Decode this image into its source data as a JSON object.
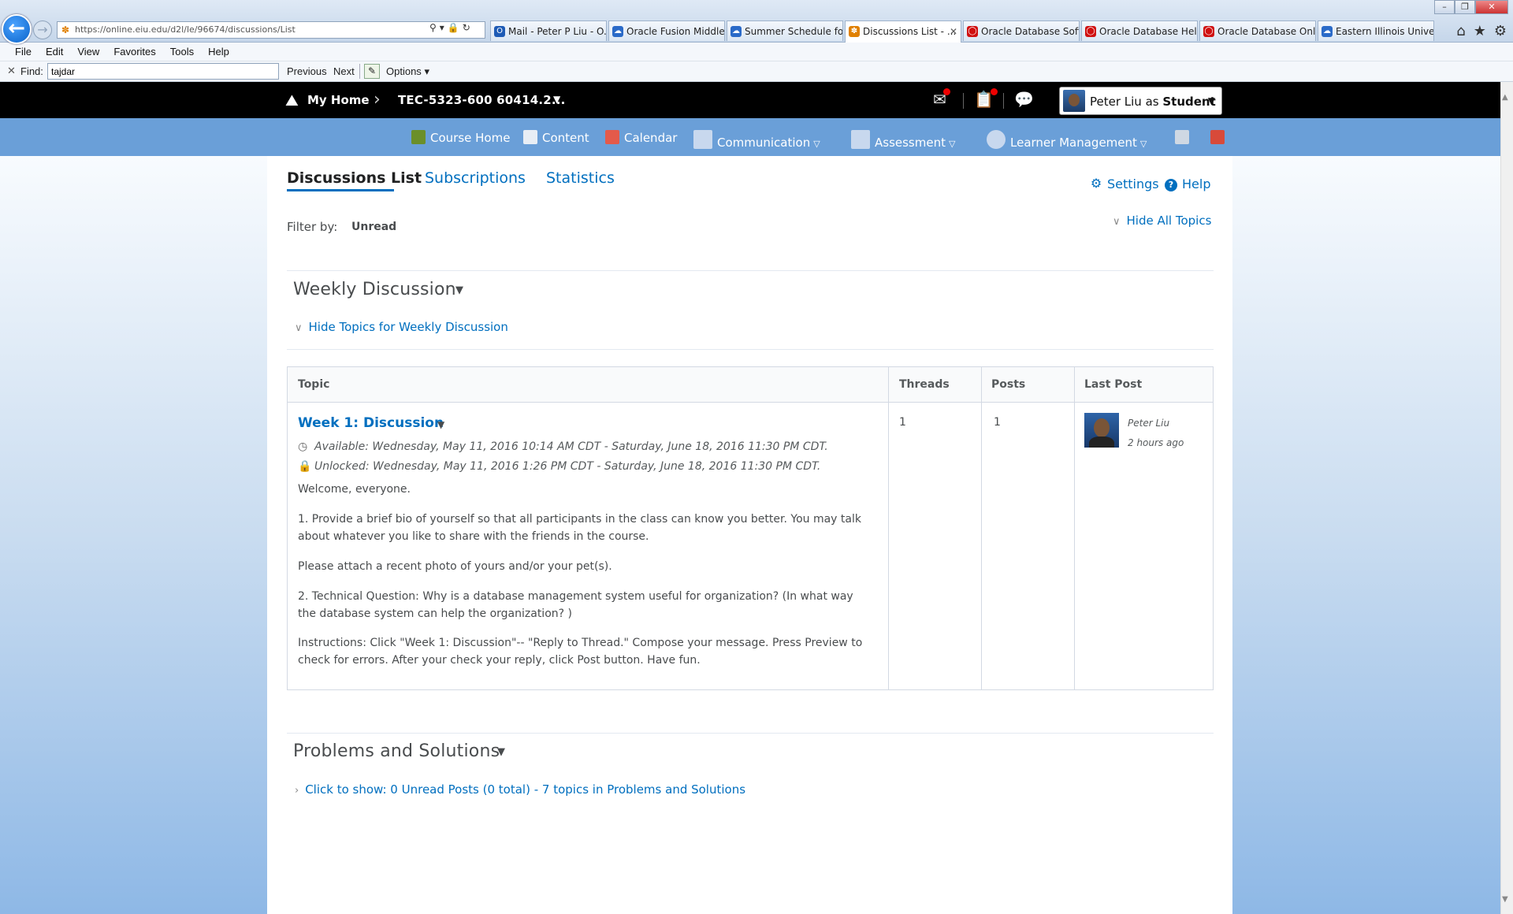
{
  "browser": {
    "address": "https://online.eiu.edu/d2l/le/96674/discussions/List",
    "tabs": [
      {
        "label": "Mail - Peter P Liu - O...",
        "icon": "outlook-icon",
        "color": "#1e5bb5"
      },
      {
        "label": "Oracle Fusion Middle...",
        "icon": "page-icon",
        "color": "#2a6ac8"
      },
      {
        "label": "Summer Schedule fo...",
        "icon": "page-icon",
        "color": "#2a6ac8"
      },
      {
        "label": "Discussions List - ...",
        "icon": "d2l-icon",
        "color": "#e08000",
        "active": true
      },
      {
        "label": "Oracle Database Soft...",
        "icon": "oracle-icon",
        "color": "#d01010"
      },
      {
        "label": "Oracle Database Hel...",
        "icon": "oracle-icon",
        "color": "#d01010"
      },
      {
        "label": "Oracle Database Onli...",
        "icon": "oracle-icon",
        "color": "#d01010"
      },
      {
        "label": "Eastern Illinois Unive...",
        "icon": "page-icon",
        "color": "#2a6ac8"
      }
    ],
    "menu": [
      "File",
      "Edit",
      "View",
      "Favorites",
      "Tools",
      "Help"
    ],
    "find": {
      "label": "Find:",
      "value": "tajdar",
      "previous": "Previous",
      "next": "Next",
      "options": "Options"
    }
  },
  "topnav": {
    "home": "My Home",
    "course": "TEC-5323-600 60414.2...",
    "user_name": "Peter Liu as ",
    "user_role": "Student"
  },
  "bluenav": {
    "items": [
      "Course Home",
      "Content",
      "Calendar",
      "Communication",
      "Assessment",
      "Learner Management"
    ]
  },
  "page": {
    "tabs": [
      "Discussions List",
      "Subscriptions",
      "Statistics"
    ],
    "settings": "Settings",
    "help": "Help",
    "filter_label": "Filter by:",
    "filter_value": "Unread",
    "hide_all": "Hide All Topics"
  },
  "forums": [
    {
      "title": "Weekly Discussion",
      "hide_link": "Hide Topics for Weekly Discussion",
      "columns": [
        "Topic",
        "Threads",
        "Posts",
        "Last Post"
      ],
      "topic": {
        "title": "Week 1: Discussion",
        "available": "Available: Wednesday, May 11, 2016 10:14 AM CDT - Saturday, June 18, 2016 11:30 PM CDT.",
        "unlocked": "Unlocked: Wednesday, May 11, 2016 1:26 PM CDT - Saturday, June 18, 2016 11:30 PM CDT.",
        "body": [
          "Welcome, everyone.",
          "1. Provide a brief bio of yourself so that all participants in the class can know you better. You may talk about whatever you like to share with the friends in the course.",
          "Please attach a recent photo of yours and/or your pet(s).",
          "2. Technical Question: Why is a database management system useful for organization? (In what way the database system can help the organization? )",
          "Instructions: Click \"Week 1: Discussion\"-- \"Reply to Thread.\" Compose your message. Press Preview to check for errors. After your check your reply, click Post button. Have fun."
        ],
        "threads": "1",
        "posts": "1",
        "last_post_name": "Peter Liu",
        "last_post_time": "2 hours ago"
      }
    },
    {
      "title": "Problems and Solutions",
      "show_link": "Click to show: 0 Unread Posts (0 total) - 7 topics in Problems and Solutions"
    }
  ],
  "colors": {
    "link": "#006fbf",
    "nav_blue": "#6a9fd8",
    "topbar": "#000000"
  }
}
